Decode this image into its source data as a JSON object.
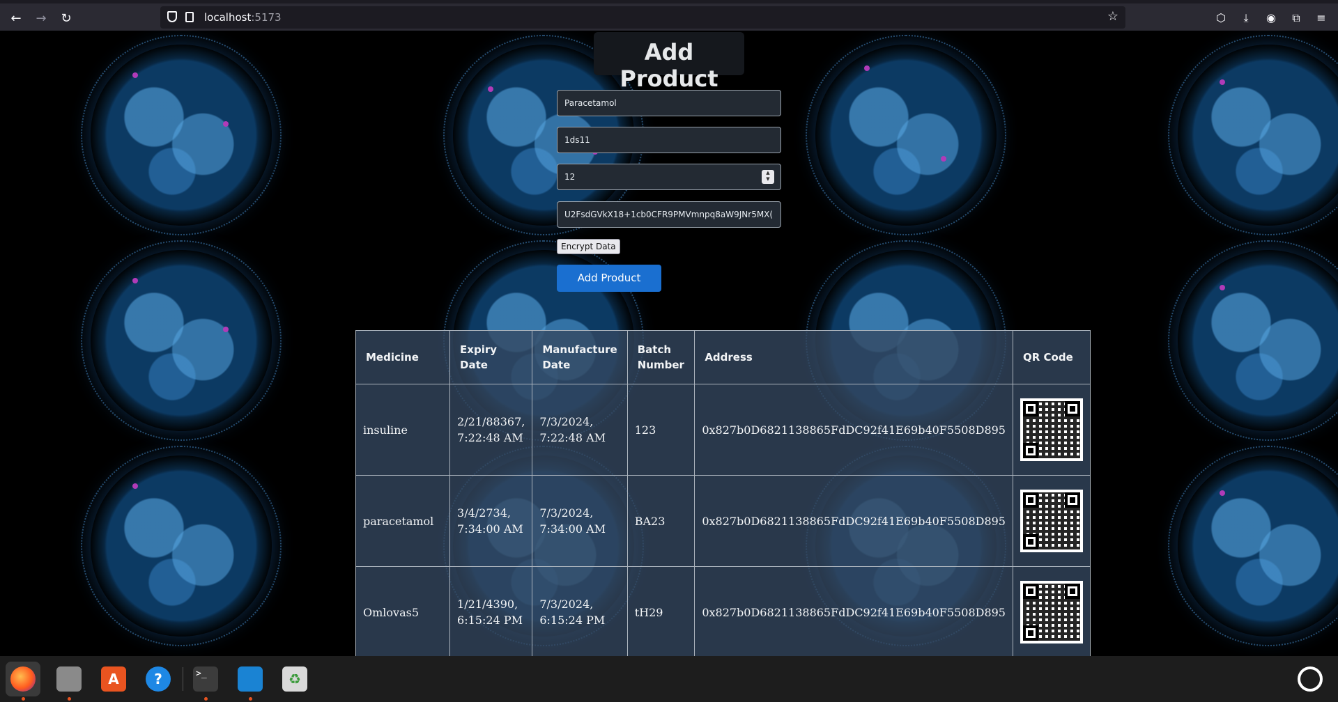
{
  "browser": {
    "back": "←",
    "forward": "→",
    "reload": "↻",
    "url_host": "localhost",
    "url_port": ":5173",
    "star": "☆"
  },
  "form": {
    "title": "Add Product",
    "medicine_value": "Paracetamol",
    "batch_value": "1ds11",
    "quantity_value": "12",
    "encrypted_value": "U2FsdGVkX18+1cb0CFR9PMVmnpq8aW9JNr5MX(",
    "encrypt_button": "Encrypt Data",
    "add_button": "Add Product"
  },
  "table": {
    "headers": [
      "Medicine",
      "Expiry Date",
      "Manufacture Date",
      "Batch Number",
      "Address",
      "QR Code"
    ],
    "rows": [
      {
        "medicine": "insuline",
        "expiry": "2/21/88367, 7:22:48 AM",
        "manufacture": "7/3/2024, 7:22:48 AM",
        "batch": "123",
        "address": "0x827b0D6821138865FdDC92f41E69b40F5508D895"
      },
      {
        "medicine": "paracetamol",
        "expiry": "3/4/2734, 7:34:00 AM",
        "manufacture": "7/3/2024, 7:34:00 AM",
        "batch": "BA23",
        "address": "0x827b0D6821138865FdDC92f41E69b40F5508D895"
      },
      {
        "medicine": "Omlovas5",
        "expiry": "1/21/4390, 6:15:24 PM",
        "manufacture": "7/3/2024, 6:15:24 PM",
        "batch": "tH29",
        "address": "0x827b0D6821138865FdDC92f41E69b40F5508D895"
      }
    ]
  },
  "taskbar": {
    "apps": [
      "firefox-icon",
      "files-icon",
      "app-center-icon",
      "help-icon",
      "terminal-icon",
      "vscode-icon",
      "trash-icon"
    ],
    "help_glyph": "?",
    "terminal_glyph": ">_",
    "appcenter_glyph": "A"
  },
  "colors": {
    "accent_button": "#1a6fd0",
    "table_bg": "#344860",
    "chrome_bg": "#2b2a33"
  }
}
